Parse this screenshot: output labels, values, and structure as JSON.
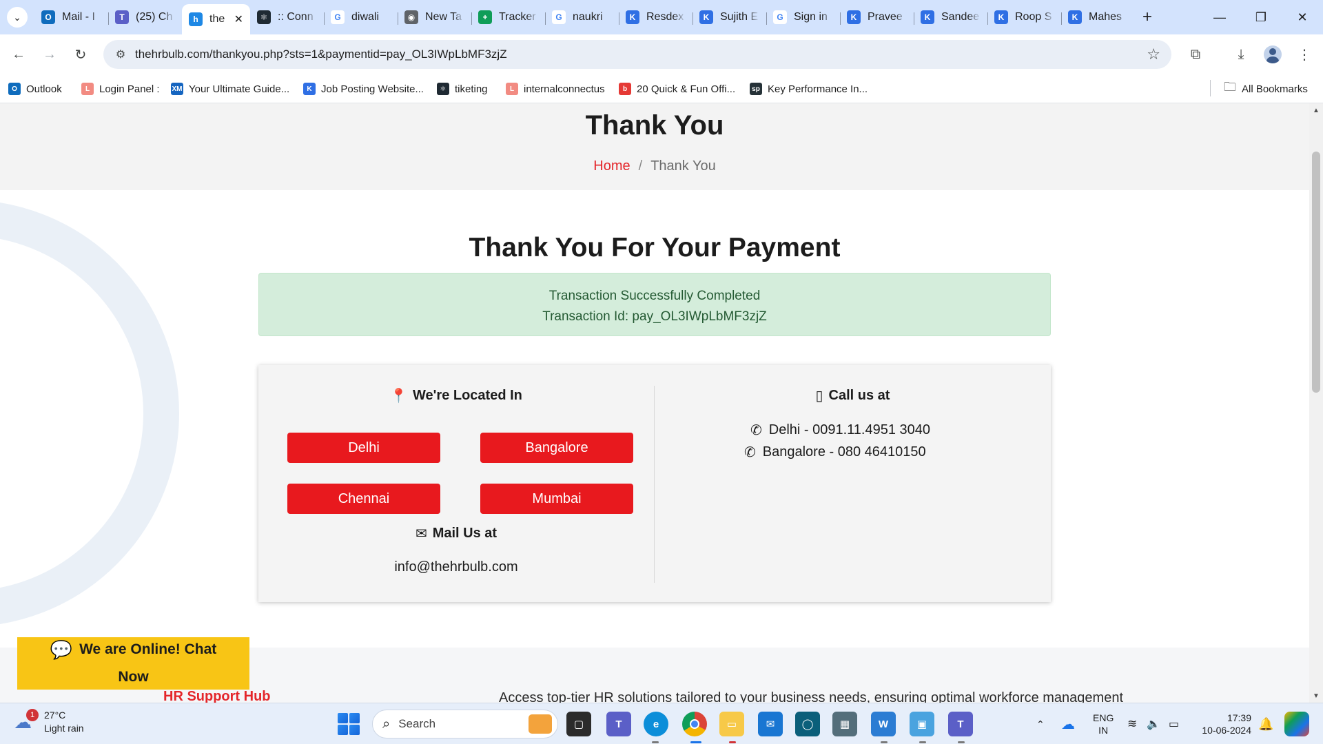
{
  "browser": {
    "tabs": [
      {
        "title": "Mail - I",
        "color": "#0f6cbd",
        "glyph": "O"
      },
      {
        "title": "(25) Ch",
        "color": "#5b5fc7",
        "glyph": "T"
      },
      {
        "title": "the",
        "color": "#1e88e5",
        "glyph": "h",
        "active": true
      },
      {
        "title": ":: Conn",
        "color": "#1f2a33",
        "glyph": "⚛"
      },
      {
        "title": "diwali",
        "color": "#ffffff",
        "glyph": "G"
      },
      {
        "title": "New Ta",
        "color": "#5f6368",
        "glyph": "◉"
      },
      {
        "title": "Tracker",
        "color": "#0f9d58",
        "glyph": "+"
      },
      {
        "title": "naukri",
        "color": "#ffffff",
        "glyph": "G"
      },
      {
        "title": "Resdex",
        "color": "#2f6fe4",
        "glyph": "K"
      },
      {
        "title": "Sujith E",
        "color": "#2f6fe4",
        "glyph": "K"
      },
      {
        "title": "Sign in",
        "color": "#ffffff",
        "glyph": "G"
      },
      {
        "title": "Pravee",
        "color": "#2f6fe4",
        "glyph": "K"
      },
      {
        "title": "Sandee",
        "color": "#2f6fe4",
        "glyph": "K"
      },
      {
        "title": "Roop S",
        "color": "#2f6fe4",
        "glyph": "K"
      },
      {
        "title": "Mahes",
        "color": "#2f6fe4",
        "glyph": "K"
      }
    ],
    "url": "thehrbulb.com/thankyou.php?sts=1&paymentid=pay_OL3IWpLbMF3zjZ",
    "bookmarks": [
      {
        "label": "Outlook",
        "color": "#0f6cbd",
        "glyph": "O"
      },
      {
        "label": "Login Panel :",
        "color": "#f28b82",
        "glyph": "L"
      },
      {
        "label": "Your Ultimate Guide...",
        "color": "#1565c0",
        "glyph": "XM"
      },
      {
        "label": "Job Posting Website...",
        "color": "#2f6fe4",
        "glyph": "K"
      },
      {
        "label": "tiketing",
        "color": "#1f2a33",
        "glyph": "⚛"
      },
      {
        "label": "internalconnectus",
        "color": "#f28b82",
        "glyph": "L"
      },
      {
        "label": "20 Quick & Fun Offi...",
        "color": "#e53935",
        "glyph": "b"
      },
      {
        "label": "Key Performance In...",
        "color": "#263238",
        "glyph": "sp"
      }
    ],
    "all_bookmarks": "All Bookmarks"
  },
  "page": {
    "banner_title": "Thank You",
    "breadcrumb": {
      "home": "Home",
      "separator": "/",
      "current": "Thank You"
    },
    "payment_title": "Thank You For Your Payment",
    "alert": {
      "line1": "Transaction Successfully Completed",
      "line2": "Transaction Id: pay_OL3IWpLbMF3zjZ"
    },
    "contact": {
      "located_heading": "We're Located In",
      "cities": [
        "Delhi",
        "Bangalore",
        "Chennai",
        "Mumbai"
      ],
      "mail_heading": "Mail Us at",
      "email": "info@thehrbulb.com",
      "call_heading": "Call us at",
      "phones": [
        "Delhi - 0091.11.4951 3040",
        "Bangalore - 080 46410150"
      ]
    },
    "chat_widget": {
      "line1": "We are Online! Chat",
      "line2": "Now"
    },
    "hr_support": "HR Support Hub",
    "footer_text": "Access top-tier HR solutions tailored to your business needs, ensuring optimal workforce management"
  },
  "taskbar": {
    "weather": {
      "temp": "27°C",
      "condition": "Light rain",
      "badge": "1"
    },
    "search_placeholder": "Search",
    "lang": {
      "line1": "ENG",
      "line2": "IN"
    },
    "clock": {
      "time": "17:39",
      "date": "10-06-2024"
    }
  },
  "colors": {
    "accent_red": "#e8191e",
    "alert_green_bg": "#d4eddb",
    "chat_yellow": "#f8c515"
  }
}
